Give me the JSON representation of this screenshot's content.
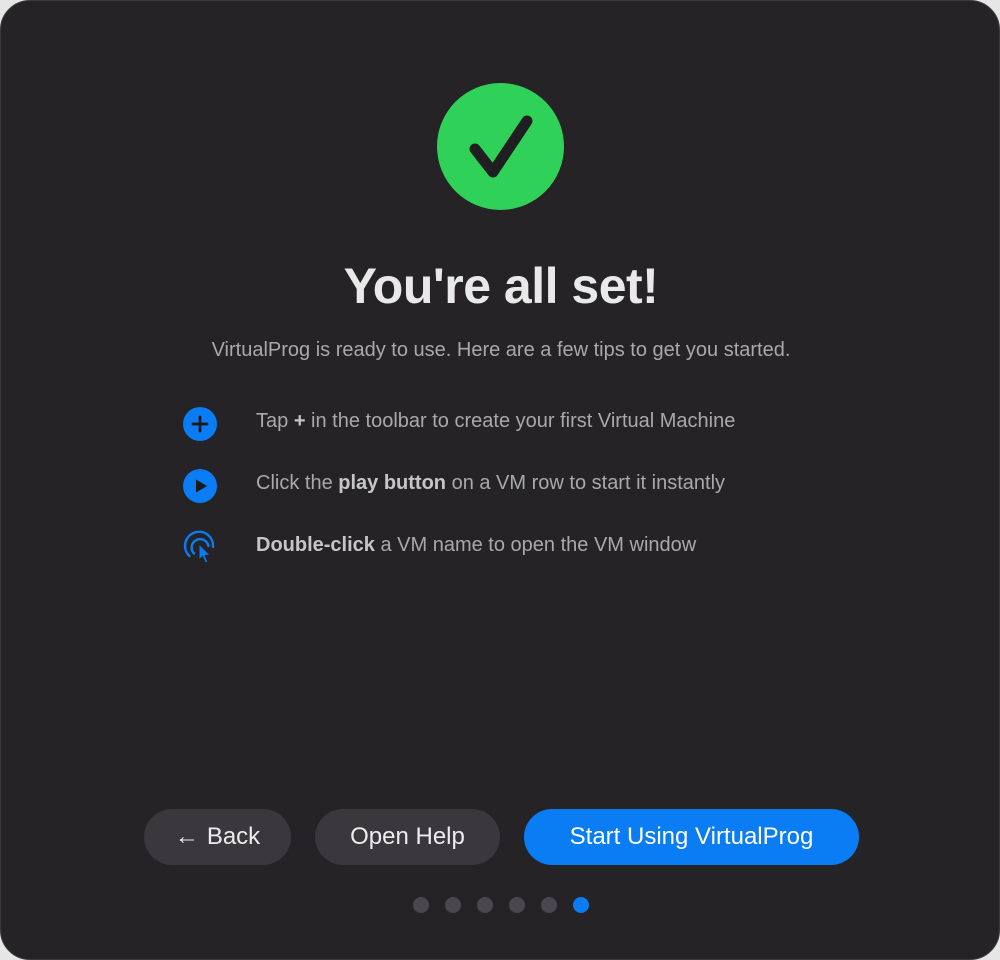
{
  "colors": {
    "background": "#252326",
    "success": "#30d158",
    "accent": "#0a7cf4",
    "secondary_button": "#3a383c",
    "dot_inactive": "#4a484c"
  },
  "header": {
    "icon": "checkmark-circle-icon",
    "title": "You're all set!",
    "subtitle": "VirtualProg is ready to use. Here are a few tips to get you started."
  },
  "tips": [
    {
      "icon": "plus-circle-icon",
      "before": "Tap ",
      "bold": "+",
      "after": " in the toolbar to create your first Virtual Machine"
    },
    {
      "icon": "play-circle-icon",
      "before": "Click the ",
      "bold": "play button",
      "after": " on a VM row to start it instantly"
    },
    {
      "icon": "double-click-icon",
      "before": "",
      "bold": "Double-click",
      "after": " a VM name to open the VM window"
    }
  ],
  "buttons": {
    "back_arrow": "←",
    "back_label": "Back",
    "help_label": "Open Help",
    "start_label": "Start Using VirtualProg"
  },
  "pagination": {
    "total": 6,
    "current": 6
  }
}
